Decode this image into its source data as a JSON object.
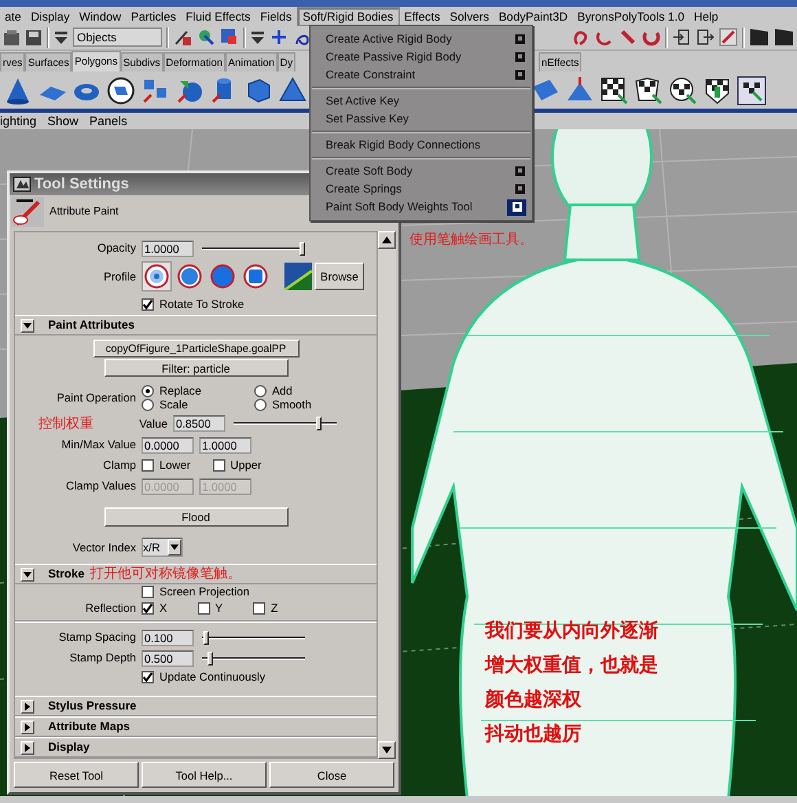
{
  "menu_bar": [
    {
      "label": "ate",
      "selected": false
    },
    {
      "label": "Display",
      "selected": false
    },
    {
      "label": "Window",
      "selected": false
    },
    {
      "label": "Particles",
      "selected": false
    },
    {
      "label": "Fluid Effects",
      "selected": false
    },
    {
      "label": "Fields",
      "selected": false
    },
    {
      "label": "Soft/Rigid Bodies",
      "selected": true
    },
    {
      "label": "Effects",
      "selected": false
    },
    {
      "label": "Solvers",
      "selected": false
    },
    {
      "label": "BodyPaint3D",
      "selected": false
    },
    {
      "label": "ByronsPolyTools 1.0",
      "selected": false
    },
    {
      "label": "Help",
      "selected": false
    }
  ],
  "status_line": {
    "selection_mode": "Objects"
  },
  "shelf_tabs": [
    {
      "label": "rves",
      "selected": false
    },
    {
      "label": "Surfaces",
      "selected": false
    },
    {
      "label": "Polygons",
      "selected": true
    },
    {
      "label": "Subdivs",
      "selected": false
    },
    {
      "label": "Deformation",
      "selected": false
    },
    {
      "label": "Animation",
      "selected": false
    },
    {
      "label": "Dy",
      "selected": false
    }
  ],
  "shelf_tabs_right": [
    {
      "label": "nEffects",
      "selected": false
    }
  ],
  "panel_menu": [
    "ighting",
    "Show",
    "Panels"
  ],
  "dropdown_menu": {
    "items": [
      {
        "kind": "item",
        "label": "Create Active Rigid Body",
        "option_box": true,
        "highlighted": false
      },
      {
        "kind": "item",
        "label": "Create Passive Rigid Body",
        "option_box": true,
        "highlighted": false
      },
      {
        "kind": "item",
        "label": "Create Constraint",
        "option_box": true,
        "highlighted": false
      },
      {
        "kind": "separator"
      },
      {
        "kind": "item",
        "label": "Set Active Key",
        "option_box": false
      },
      {
        "kind": "item",
        "label": "Set Passive Key",
        "option_box": false
      },
      {
        "kind": "separator"
      },
      {
        "kind": "item",
        "label": "Break Rigid Body Connections",
        "option_box": false
      },
      {
        "kind": "separator"
      },
      {
        "kind": "item",
        "label": "Create Soft Body",
        "option_box": true,
        "highlighted": false
      },
      {
        "kind": "item",
        "label": "Create Springs",
        "option_box": true,
        "highlighted": false
      },
      {
        "kind": "item",
        "label": "Paint Soft Body Weights Tool",
        "option_box": true,
        "highlighted": true
      }
    ]
  },
  "tool_settings": {
    "title": "Tool Settings",
    "tool_name": "Attribute Paint",
    "opacity": {
      "label": "Opacity",
      "value": "1.0000",
      "level": 1
    },
    "profile": {
      "label": "Profile",
      "brushes": [
        {
          "kind": "soft",
          "selected": true
        },
        {
          "kind": "medium",
          "selected": false
        },
        {
          "kind": "solid",
          "selected": false
        },
        {
          "kind": "square",
          "selected": false
        }
      ],
      "browse": "Browse"
    },
    "rotate_to_stroke": {
      "label": "Rotate To Stroke",
      "checked": true
    },
    "paint_attributes": {
      "title": "Paint Attributes",
      "expanded": true,
      "attribute_button": "copyOfFigure_1ParticleShape.goalPP",
      "filter_button": "Filter: particle",
      "operation_label": "Paint Operation",
      "operations": [
        {
          "label": "Replace",
          "selected": true
        },
        {
          "label": "Add",
          "selected": false
        },
        {
          "label": "Scale",
          "selected": false
        },
        {
          "label": "Smooth",
          "selected": false
        }
      ],
      "note": "控制权重",
      "value": {
        "label": "Value",
        "value": "0.8500",
        "level": 0.85
      },
      "min_max": {
        "label": "Min/Max Value",
        "min": "0.0000",
        "max": "1.0000"
      },
      "clamp": {
        "label": "Clamp",
        "options": [
          {
            "label": "Lower",
            "checked": false
          },
          {
            "label": "Upper",
            "checked": false
          }
        ]
      },
      "clamp_values": {
        "label": "Clamp Values",
        "min": "0.0000",
        "max": "1.0000",
        "disabled": true
      },
      "flood": "Flood",
      "vector_index": {
        "label": "Vector Index",
        "value": "x/R"
      }
    },
    "stroke": {
      "title": "Stroke",
      "expanded": true,
      "note": "打开他可对称镜像笔触。",
      "screen_projection": {
        "label": "Screen Projection",
        "checked": false
      },
      "reflection": {
        "label": "Reflection",
        "axes": [
          {
            "label": "X",
            "checked": true
          },
          {
            "label": "Y",
            "checked": false
          },
          {
            "label": "Z",
            "checked": false
          }
        ]
      },
      "stamp_spacing": {
        "label": "Stamp Spacing",
        "value": "0.100",
        "level": 0.02
      },
      "stamp_depth": {
        "label": "Stamp Depth",
        "value": "0.500",
        "level": 0.06
      },
      "update_continuously": {
        "label": "Update Continuously",
        "checked": true
      }
    },
    "collapsed_sections": [
      {
        "title": "Stylus Pressure",
        "expanded": false
      },
      {
        "title": "Attribute Maps",
        "expanded": false
      },
      {
        "title": "Display",
        "expanded": false
      }
    ],
    "buttons": [
      "Reset Tool",
      "Tool Help...",
      "Close"
    ]
  },
  "viewport": {
    "note": "使用笔触绘画工具。",
    "callout": [
      "我们要从内向外逐渐",
      "增大权重值，也就是",
      "颜色越深权",
      "抖动也越厉"
    ]
  }
}
